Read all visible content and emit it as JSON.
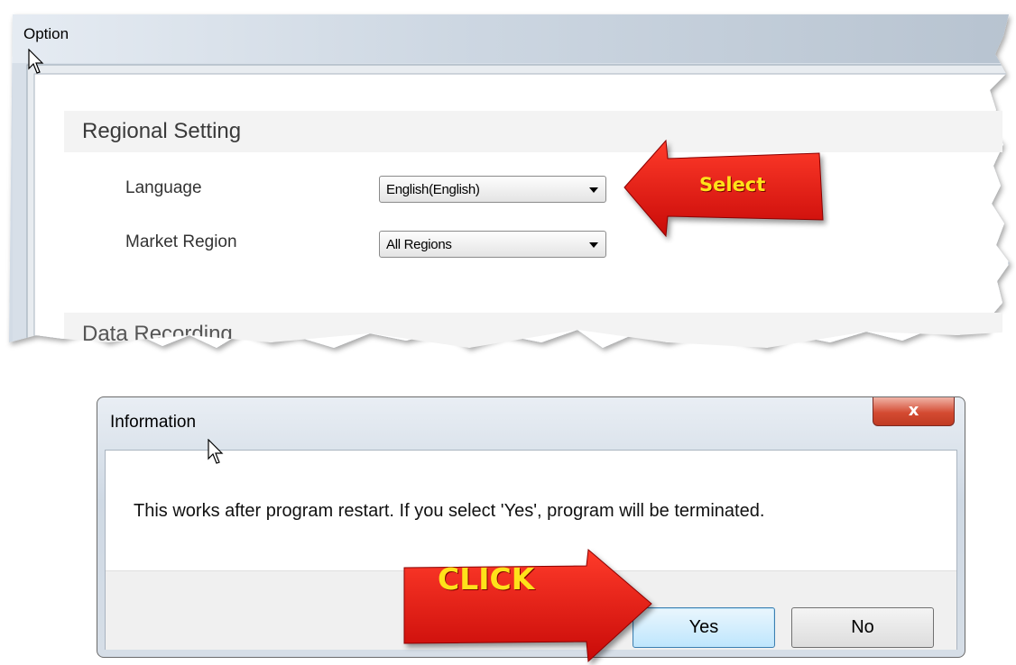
{
  "option_window": {
    "title": "Option",
    "regional_section": {
      "header": "Regional Setting",
      "language_label": "Language",
      "language_value": "English(English)",
      "region_label": "Market Region",
      "region_value": "All Regions"
    },
    "data_section": {
      "header": "Data Recording"
    },
    "callout": "Select"
  },
  "info_dialog": {
    "title": "Information",
    "close_label": "x",
    "message": "This works after program restart. If you select 'Yes', program will be terminated.",
    "yes_label": "Yes",
    "no_label": "No",
    "callout": "CLICK"
  },
  "colors": {
    "arrow_red": "#e8120f",
    "callout_text": "#ffe21a",
    "yes_button": "#bee6fd"
  },
  "icons": [
    "mouse-cursor-icon",
    "red-arrow-icon",
    "close-icon",
    "dropdown-arrow-icon"
  ]
}
